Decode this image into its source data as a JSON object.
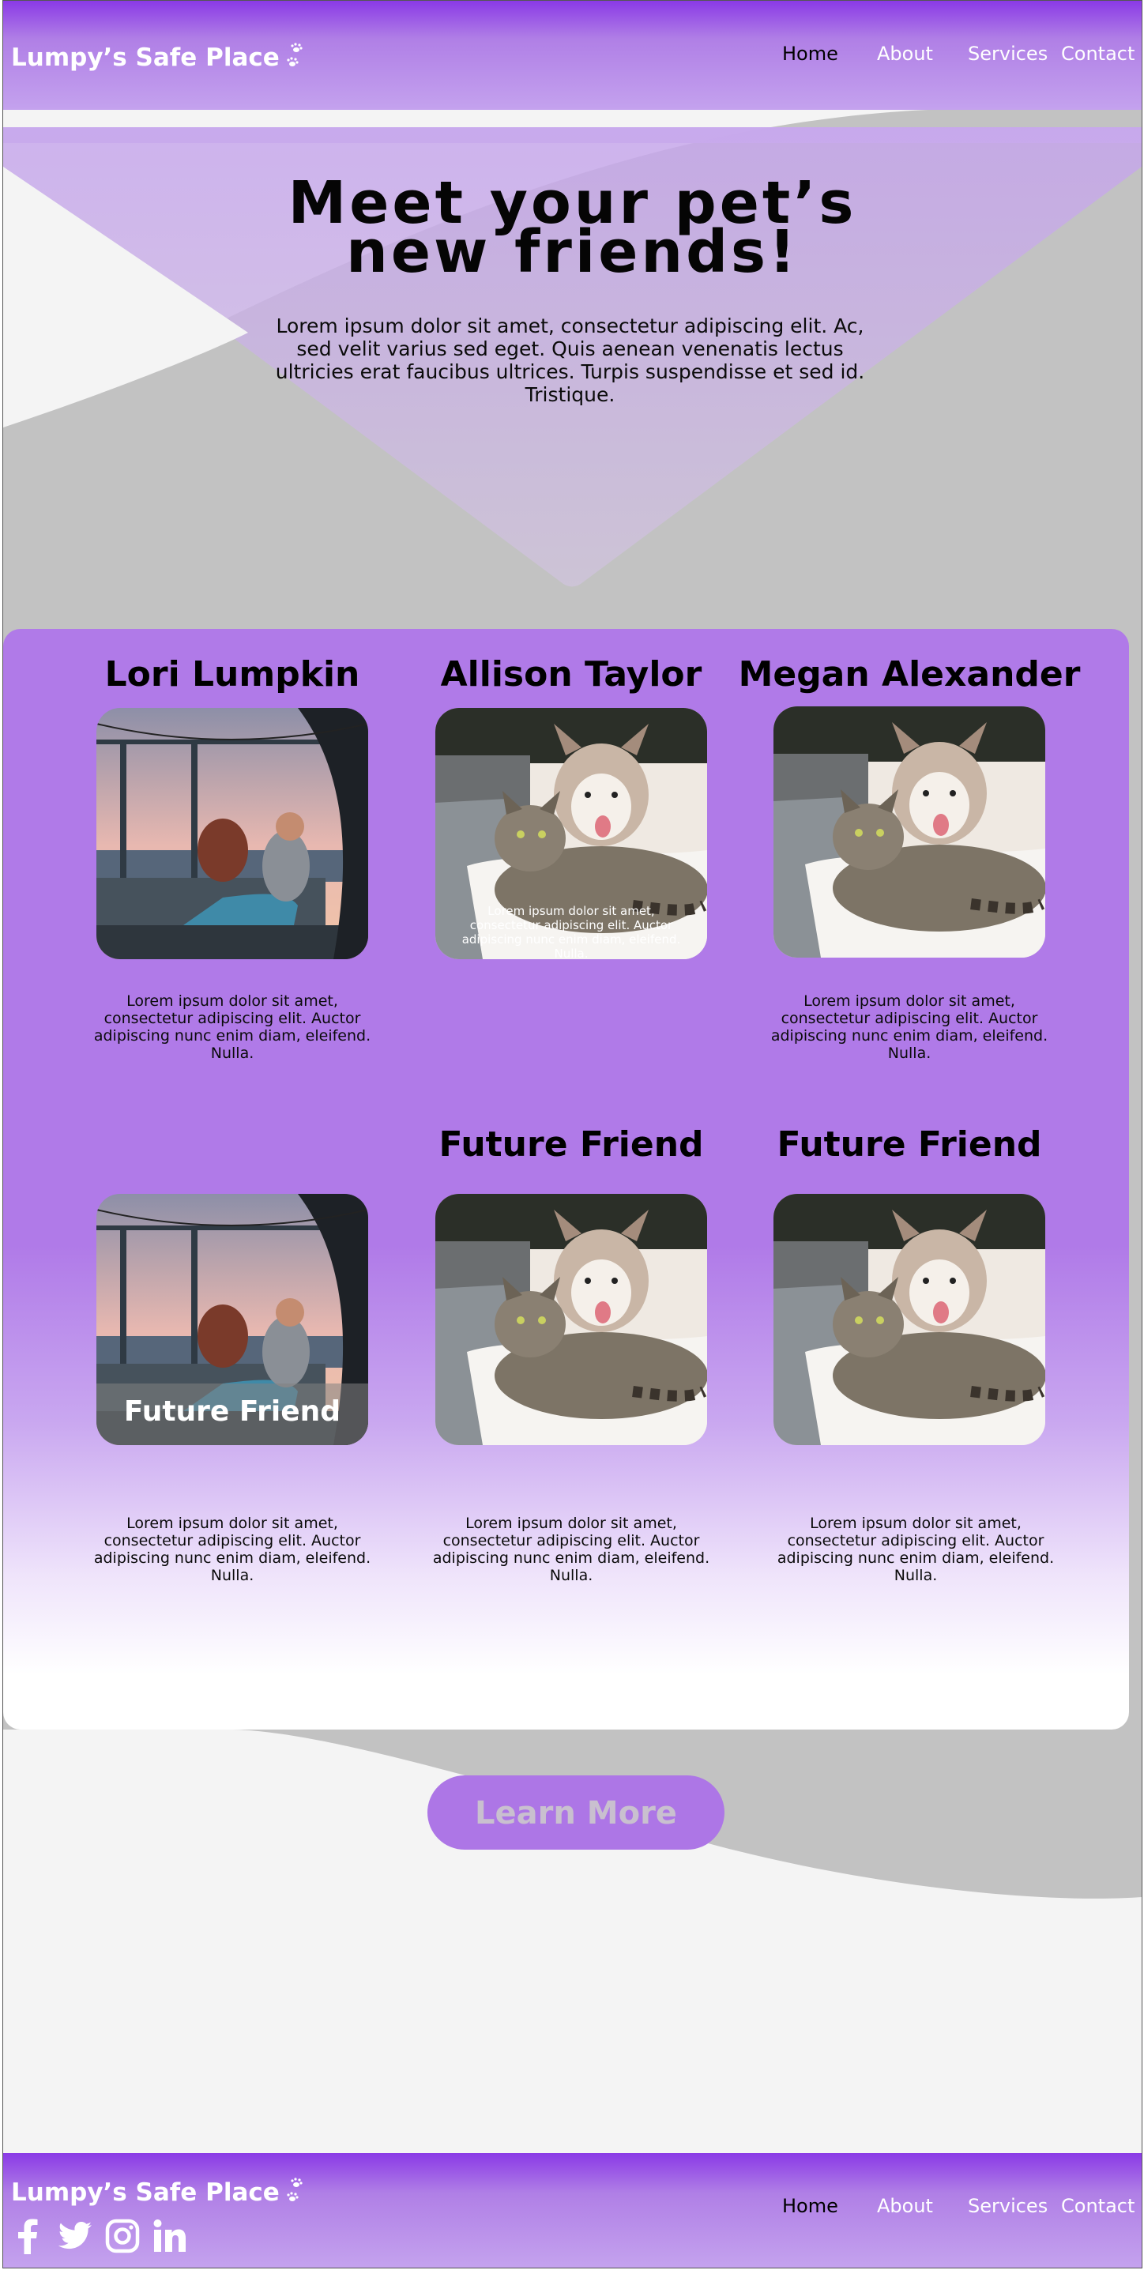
{
  "brand": "Lumpy’s Safe Place",
  "nav": [
    {
      "label": "Home"
    },
    {
      "label": "About"
    },
    {
      "label": "Services"
    },
    {
      "label": "Contact"
    }
  ],
  "hero": {
    "title_line1": "Meet your pet’s",
    "title_line2": "new friends!",
    "text": "Lorem ipsum dolor sit amet, consectetur adipiscing elit. Ac, sed velit varius sed eget. Quis aenean venenatis lectus ultricies erat faucibus ultrices. Turpis suspendisse et sed id. Tristique."
  },
  "friends": [
    {
      "name": "Lori Lumpkin",
      "photo": "woman-with-dog-photo",
      "description": "Lorem ipsum dolor sit amet, consectetur adipiscing elit. Auctor adipiscing nunc enim diam, eleifend. Nulla."
    },
    {
      "name": "Allison Taylor",
      "photo": "dog-and-cat-photo",
      "overlay": "Lorem ipsum dolor sit amet, consectetur adipiscing elit. Auctor adipiscing nunc enim diam, eleifend. Nulla."
    },
    {
      "name": "Megan Alexander",
      "photo": "dog-and-cat-photo",
      "description": "Lorem ipsum dolor sit amet, consectetur adipiscing elit. Auctor adipiscing nunc enim diam, eleifend. Nulla."
    },
    {
      "name": "",
      "photo": "woman-with-dog-photo",
      "overlay": "Future Friend",
      "description": "Lorem ipsum dolor sit amet, consectetur adipiscing elit. Auctor adipiscing nunc enim diam, eleifend. Nulla."
    },
    {
      "name": "Future Friend",
      "photo": "dog-and-cat-photo",
      "description": "Lorem ipsum dolor sit amet, consectetur adipiscing elit. Auctor adipiscing nunc enim diam, eleifend. Nulla."
    },
    {
      "name": "Future Friend",
      "photo": "dog-and-cat-photo",
      "description": "Lorem ipsum dolor sit amet, consectetur adipiscing elit. Auctor adipiscing nunc enim diam, eleifend. Nulla."
    }
  ],
  "cta": {
    "label": "Learn More"
  },
  "footer": {
    "brand": "Lumpy’s Safe Place",
    "social": [
      "facebook-icon",
      "twitter-icon",
      "instagram-icon",
      "linkedin-icon"
    ]
  },
  "colors": {
    "accent": "#b07ae8",
    "header": "#8a3ae6",
    "button": "#ad76e6"
  }
}
